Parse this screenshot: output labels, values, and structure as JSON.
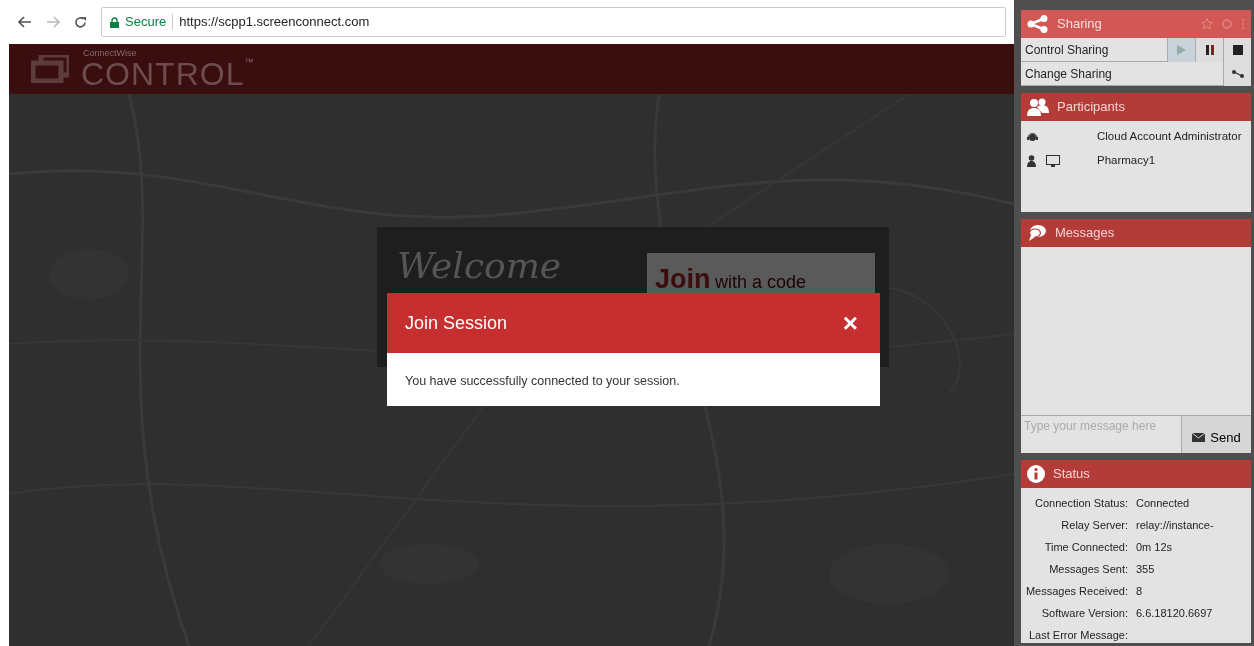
{
  "browser": {
    "secure_label": "Secure",
    "url": "https://scpp1.screenconnect.com"
  },
  "header": {
    "brand_small": "ConnectWise",
    "brand": "CONTROL",
    "trademark": "™"
  },
  "welcome": {
    "title": "Welcome",
    "join_bold": "Join",
    "join_rest": "with a code"
  },
  "dialog": {
    "title": "Join Session",
    "close": "×",
    "message": "You have successfully connected to your session."
  },
  "sharing": {
    "title": "Sharing",
    "rows": [
      {
        "label": "Control Sharing",
        "kind": "playback"
      },
      {
        "label": "Change Sharing",
        "kind": "connector"
      }
    ]
  },
  "participants": {
    "title": "Participants",
    "items": [
      {
        "name": "Cloud Account Administrator",
        "kind": "host"
      },
      {
        "name": "Pharmacy1",
        "kind": "guest"
      }
    ]
  },
  "messages": {
    "title": "Messages",
    "placeholder": "Type your message here",
    "send": "Send"
  },
  "status": {
    "title": "Status",
    "rows": [
      {
        "label": "Connection Status:",
        "value": "Connected"
      },
      {
        "label": "Relay Server:",
        "value": "relay://instance-"
      },
      {
        "label": "Time Connected:",
        "value": "0m 12s"
      },
      {
        "label": "Messages Sent:",
        "value": "355"
      },
      {
        "label": "Messages Received:",
        "value": "8"
      },
      {
        "label": "Software Version:",
        "value": "6.6.18120.6697"
      },
      {
        "label": "Last Error Message:"
      }
    ]
  }
}
